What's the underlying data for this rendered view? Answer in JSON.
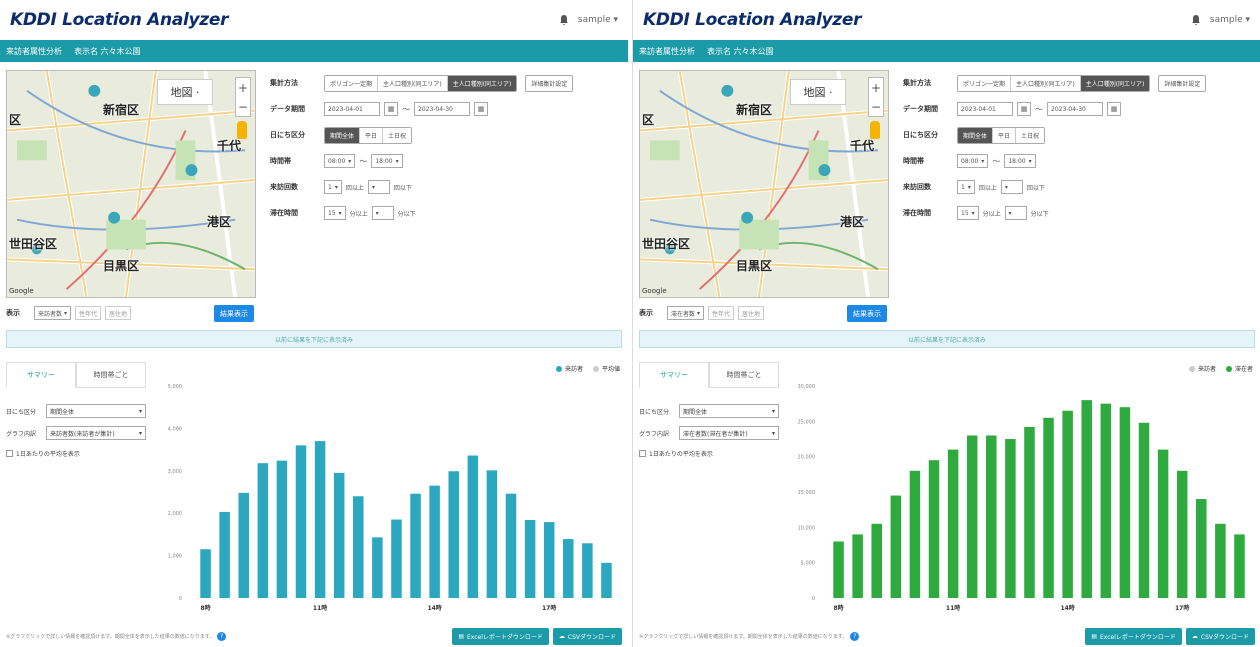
{
  "left": {
    "app_title": "KDDI Location Analyzer",
    "user_label": "sample ▾",
    "nav": [
      "来訪者属性分析",
      "表示名 六々木公園"
    ],
    "map": {
      "type_label": "地図 ·",
      "labels": [
        "新宿区",
        "区",
        "千代",
        "港区",
        "世田谷区",
        "目黒区"
      ],
      "footer": "Google"
    },
    "form": {
      "method_label": "集計方法",
      "method_options": [
        "ポリゴン一定期",
        "主人口種別(同エリア)",
        "主人口種別(同エリア)"
      ],
      "method_active": 2,
      "detail_button": "詳細集計設定",
      "period_label": "データ期間",
      "date_from": "2023-04-01",
      "date_to": "2023-04-30",
      "day_label": "日にち区分",
      "day_options": [
        "期間全体",
        "平日",
        "土日祝"
      ],
      "day_active": 0,
      "time_label": "時間帯",
      "time_from": "08:00",
      "time_to": "18:00",
      "visit_label": "来訪回数",
      "visit_from": "1",
      "visit_from_suffix": "回以上",
      "visit_to_suffix": "回以下",
      "stay_label": "滞在時間",
      "stay_from": "15",
      "stay_from_suffix": "分以上",
      "stay_to_suffix": "分以下"
    },
    "display": {
      "label": "表示",
      "options": [
        "来訪者数",
        "性年代",
        "居住地"
      ],
      "button": "結果表示"
    },
    "banner": "以前に結果を下記に表示済み",
    "tabs": [
      "サマリー",
      "時間帯ごと"
    ],
    "side": {
      "day_label": "日にち区分",
      "day_value": "期間全体",
      "graph_label": "グラフ内訳",
      "graph_value": "来訪者数(来訪者が集計)",
      "checkbox_label": "1日あたりの平均を表示"
    },
    "legend": [
      {
        "name": "来訪者",
        "active": true,
        "color": "#2ba8c0"
      },
      {
        "name": "平均値",
        "active": false,
        "color": "#cccccc"
      }
    ],
    "footer_note": "※グラフクリックで詳しい情報を確認頂けます。期間全体を表示した結果の数値になります。",
    "footer_buttons": [
      "Excelレポートダウンロード",
      "CSVダウンロード"
    ],
    "chart_data": {
      "type": "bar",
      "color": "#2ba8c0",
      "categories": [
        "8時",
        "",
        "",
        "11時",
        "",
        "",
        "14時",
        "",
        "",
        "17時",
        "",
        ""
      ],
      "x_ticks": [
        "8時",
        "11時",
        "14時",
        "17時"
      ],
      "values": [
        1150,
        2030,
        2480,
        3180,
        3240,
        3600,
        3700,
        2950,
        2400,
        1430,
        1850,
        2460,
        2650,
        2990,
        3360,
        3010,
        2460,
        1840,
        1790,
        1390,
        1290,
        830
      ],
      "ylim": [
        0,
        5000
      ],
      "yticks": [
        "0",
        "1,000",
        "2,000",
        "3,000",
        "4,000",
        "5,000"
      ],
      "xtick_labels": [
        "8時",
        "11時",
        "14時",
        "17時"
      ],
      "xtick_index": [
        0,
        6,
        12,
        18
      ]
    }
  },
  "right": {
    "app_title": "KDDI Location Analyzer",
    "user_label": "sample ▾",
    "nav": [
      "来訪者属性分析",
      "表示名 六々木公園"
    ],
    "map": {
      "type_label": "地図 ·",
      "labels": [
        "新宿区",
        "区",
        "千代",
        "港区",
        "世田谷区",
        "目黒区"
      ],
      "footer": "Google"
    },
    "form": {
      "method_label": "集計方法",
      "method_options": [
        "ポリゴン一定期",
        "主人口種別(同エリア)",
        "主人口種別(同エリア)"
      ],
      "method_active": 2,
      "detail_button": "詳細集計設定",
      "period_label": "データ期間",
      "date_from": "2023-04-01",
      "date_to": "2023-04-30",
      "day_label": "日にち区分",
      "day_options": [
        "期間全体",
        "平日",
        "土日祝"
      ],
      "day_active": 0,
      "time_label": "時間帯",
      "time_from": "08:00",
      "time_to": "18:00",
      "visit_label": "来訪回数",
      "visit_from": "1",
      "visit_from_suffix": "回以上",
      "visit_to_suffix": "回以下",
      "stay_label": "滞在時間",
      "stay_from": "15",
      "stay_from_suffix": "分以上",
      "stay_to_suffix": "分以下"
    },
    "display": {
      "label": "表示",
      "options": [
        "滞在者数",
        "性年代",
        "居住地"
      ],
      "button": "結果表示"
    },
    "banner": "以前に結果を下記に表示済み",
    "tabs": [
      "サマリー",
      "時間帯ごと"
    ],
    "side": {
      "day_label": "日にち区分",
      "day_value": "期間全体",
      "graph_label": "グラフ内訳",
      "graph_value": "滞在者数(滞在者が集計)",
      "checkbox_label": "1日あたりの平均を表示"
    },
    "legend": [
      {
        "name": "来訪者",
        "active": false,
        "color": "#cccccc"
      },
      {
        "name": "滞在者",
        "active": true,
        "color": "#2eaa3f"
      }
    ],
    "footer_note": "※グラフクリックで詳しい情報を確認頂けます。期間全体を表示した結果の数値になります。",
    "footer_buttons": [
      "Excelレポートダウンロード",
      "CSVダウンロード"
    ],
    "chart_data": {
      "type": "bar",
      "color": "#2eaa3f",
      "values": [
        8000,
        9000,
        10500,
        14500,
        18000,
        19500,
        21000,
        23000,
        23000,
        22500,
        24200,
        25500,
        26500,
        28000,
        27500,
        27000,
        24800,
        21000,
        18000,
        14000,
        10500,
        9000
      ],
      "ylim": [
        0,
        30000
      ],
      "yticks": [
        "0",
        "5,000",
        "10,000",
        "15,000",
        "20,000",
        "25,000",
        "30,000"
      ],
      "xtick_labels": [
        "8時",
        "11時",
        "14時",
        "17時"
      ],
      "xtick_index": [
        0,
        6,
        12,
        18
      ]
    }
  }
}
